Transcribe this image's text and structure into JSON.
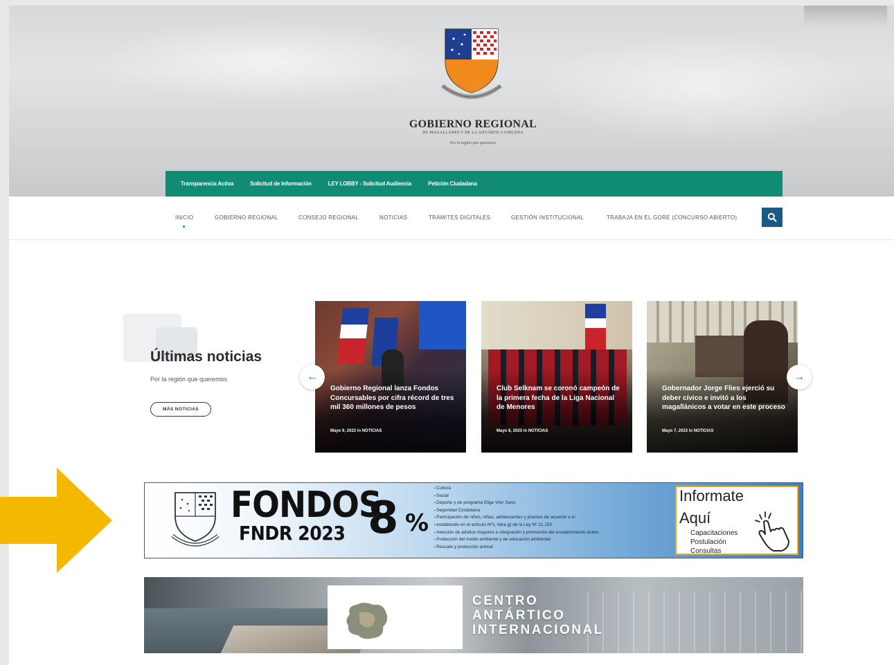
{
  "header": {
    "title": "GOBIERNO REGIONAL",
    "subtitle": "DE MAGALLANES Y DE LA ANTÁRTICA CHILENA",
    "tagline": "Por la región que queremos"
  },
  "topbar": {
    "links": [
      "Transparencia Activa",
      "Solicitud de Información",
      "LEY LOBBY - Solicitud Audiencia",
      "Petición Ciudadana"
    ]
  },
  "nav": {
    "items": [
      "INICIO",
      "GOBIERNO REGIONAL",
      "CONSEJO REGIONAL",
      "NOTICIAS",
      "TRÁMITES DIGITALES",
      "GESTIÓN INSTITUCIONAL",
      "TRABAJA EN EL GORE (CONCURSO ABIERTO)"
    ],
    "active": "INICIO",
    "search_icon": "search-icon"
  },
  "news": {
    "heading": "Últimas noticias",
    "subheading": "Por la región que queremos",
    "more_label": "MÁS NOTICIAS",
    "cards": [
      {
        "title": "Gobierno Regional lanza Fondos Concursables por cifra récord de tres mil 360 millones de pesos",
        "date": "Mayo 9, 2023 in ",
        "category": "NOTICIAS"
      },
      {
        "title": "Club Selknam se coronó campeón de la primera fecha de la Liga Nacional de Menores",
        "date": "Mayo 8, 2023 in ",
        "category": "NOTICIAS"
      },
      {
        "title": "Gobernador Jorge Flies ejerció su deber cívico e invitó a los magallánicos a votar en este proceso",
        "date": "Mayo 7, 2023 in ",
        "category": "NOTICIAS"
      }
    ],
    "prev_icon": "←",
    "next_icon": "→"
  },
  "fondos_banner": {
    "title": "FONDOS",
    "subtitle": "FNDR 2023",
    "percent_number": "8",
    "percent_sign": "%",
    "items": [
      "Cultura",
      "Social",
      "Deporte y de programa Elige Vivir Sano",
      "Seguridad Ciudadana",
      "Participación de niños, niñas, adolescentes y jóvenes de acuerdo a lo",
      "establecido en el artículo Nº1, letra g) de la Ley Nº 21.150",
      "Atención de adultos mayores e integración y promoción del envejecimiento activo",
      "Protección del medio ambiente y de educación ambiental",
      "Rescate y protección animal"
    ],
    "informate": "Informate",
    "aqui": "Aquí",
    "links": [
      "Capacitaciones",
      "Postulación",
      "Consultas"
    ]
  },
  "antartico_banner": {
    "line1": "CENTRO",
    "line2": "ANTÁRTICO",
    "line3": "INTERNACIONAL"
  },
  "colors": {
    "green": "#0f8c73",
    "search_blue": "#1b5a82",
    "arrow_yellow": "#f5b800"
  }
}
